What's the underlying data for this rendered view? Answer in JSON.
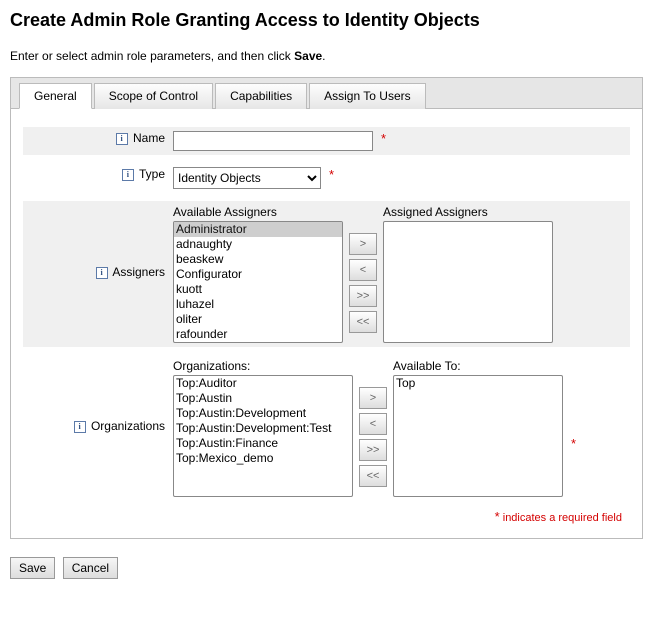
{
  "page": {
    "title": "Create Admin Role Granting Access to Identity Objects",
    "instruction_prefix": "Enter or select admin role parameters, and then click ",
    "instruction_bold": "Save",
    "instruction_suffix": "."
  },
  "tabs": [
    {
      "label": "General",
      "active": true
    },
    {
      "label": "Scope of Control",
      "active": false
    },
    {
      "label": "Capabilities",
      "active": false
    },
    {
      "label": "Assign To Users",
      "active": false
    }
  ],
  "form": {
    "name": {
      "label": "Name",
      "value": "",
      "required": true
    },
    "type": {
      "label": "Type",
      "selected": "Identity Objects",
      "options": [
        "Identity Objects"
      ],
      "required": true
    },
    "assigners": {
      "label": "Assigners",
      "available_label": "Available Assigners",
      "assigned_label": "Assigned Assigners",
      "available": [
        "Administrator",
        "adnaughty",
        "beaskew",
        "Configurator",
        "kuott",
        "luhazel",
        "oliter",
        "rafounder"
      ],
      "assigned": []
    },
    "organizations": {
      "label": "Organizations",
      "available_label": "Organizations:",
      "assigned_label": "Available To:",
      "available": [
        "Top:Auditor",
        "Top:Austin",
        "Top:Austin:Development",
        "Top:Austin:Development:Test",
        "Top:Austin:Finance",
        "Top:Mexico_demo"
      ],
      "assigned": [
        "Top"
      ],
      "required": true
    }
  },
  "buttons": {
    "add": ">",
    "remove": "<",
    "add_all": ">>",
    "remove_all": "<<"
  },
  "footer": {
    "required_note": "indicates a required field",
    "star": "*"
  },
  "actions": {
    "save": "Save",
    "cancel": "Cancel"
  }
}
